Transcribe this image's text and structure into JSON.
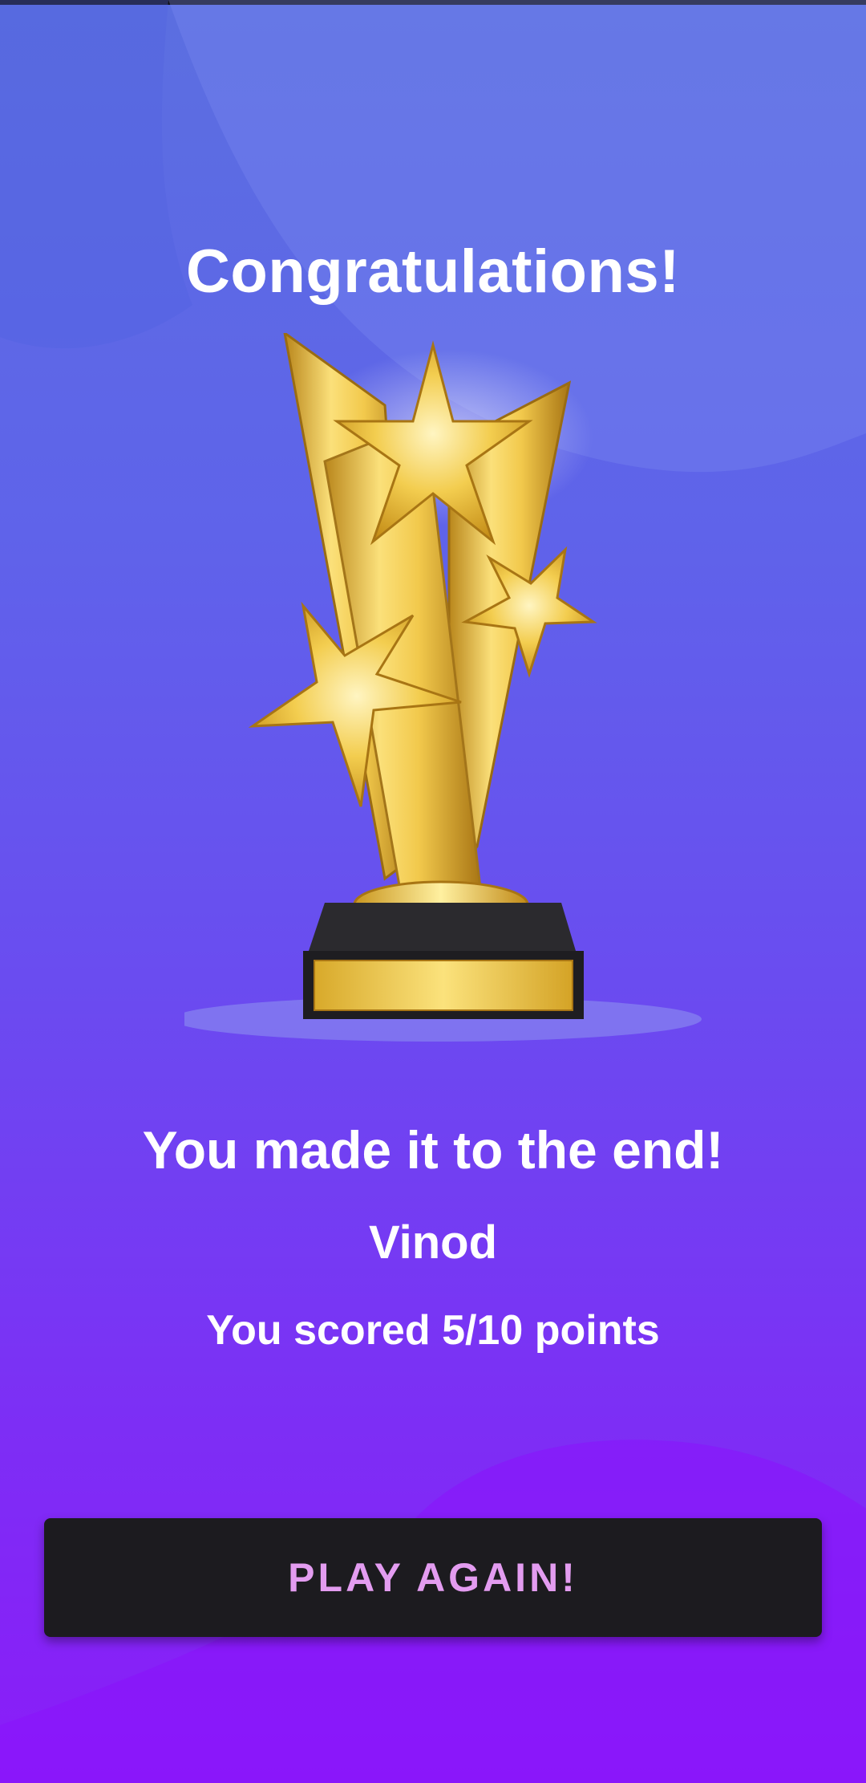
{
  "screen": {
    "title": "Congratulations!",
    "trophy_icon": "trophy-icon",
    "headline": "You made it to the end!",
    "player_name": "Vinod",
    "score_text": "You scored 5/10 points",
    "play_again_label": "PLAY AGAIN!",
    "score": 5,
    "max_score": 10
  },
  "colors": {
    "background_top": "#5b6fe0",
    "background_bottom": "#8a1cf8",
    "button_background": "#1c1b1f",
    "button_text": "#e39cf0",
    "text": "#ffffff",
    "trophy_gold": "#e8b92e"
  }
}
